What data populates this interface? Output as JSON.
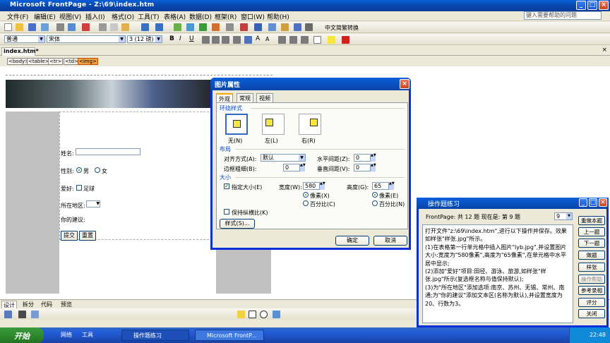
{
  "app": {
    "title": "Microsoft FrontPage - Z:\\69\\index.htm"
  },
  "menu": {
    "items": [
      "文件(F)",
      "编辑(E)",
      "视图(V)",
      "插入(I)",
      "格式(O)",
      "工具(T)",
      "表格(A)",
      "数据(D)",
      "框架(R)",
      "窗口(W)",
      "帮助(H)"
    ],
    "help_placeholder": "键入需要帮助的问题"
  },
  "format_toolbar": {
    "style": "普通",
    "font": "宋体",
    "size": "3 (12 磅)",
    "cn_convert": "中文简繁转换"
  },
  "doc_tab": "index.htm*",
  "tag_path": [
    "<body>",
    "<table>",
    "<tr>",
    "<td>",
    "<img>"
  ],
  "form": {
    "name_label": "姓名:",
    "gender_label": "性别:",
    "male": "男",
    "female": "女",
    "hobby_label": "爱好:",
    "hobby_option": "足球",
    "region_label": "所在地区:",
    "suggest_label": "你的建议:",
    "submit": "提交",
    "reset": "重置"
  },
  "view_tabs": [
    "设计",
    "拆分",
    "代码",
    "预览"
  ],
  "dialog": {
    "title": "图片属性",
    "tabs": [
      "外观",
      "常规",
      "视频"
    ],
    "wrap_section": "环绕样式",
    "wrap_options": [
      "无(N)",
      "左(L)",
      "右(R)"
    ],
    "layout_section": "布局",
    "align_label": "对齐方式(A):",
    "align_value": "默认",
    "hspace_label": "水平间距(Z):",
    "hspace_value": "0",
    "border_label": "边框粗细(B):",
    "border_value": "0",
    "vspace_label": "垂直间距(V):",
    "vspace_value": "0",
    "size_section": "大小",
    "specify_size": "指定大小(E)",
    "width_label": "宽度(W):",
    "width_value": "580",
    "height_label": "高度(G):",
    "height_value": "65",
    "pixels": "像素(X)",
    "percent": "百分比(C)",
    "pixels_h": "像素(E)",
    "percent_h": "百分比(N)",
    "keep_ratio": "保持纵横比(K)",
    "style_button": "样式(S)...",
    "ok": "确定",
    "cancel": "取消"
  },
  "practice": {
    "title": "操作题练习",
    "status": "FrontPage: 共 12 题  现在是: 第 9 题",
    "question_num": "9",
    "text": "打开文件\"z:\\69\\index.htm\",进行以下操作并保存。效果如样张\"样张.jpg\"所示。\n(1)在表格第一行单元格中插入图片\"lyb.jpg\",并设置图片大小:宽度为\"580像素\",高度为\"65像素\",在单元格中水平居中显示;\n(2)添加\"爱好\"项目:田径、游泳、旅游,如样张\"样张.jpg\"所示(复选框名称与值保持默认);\n(3)为\"所在地区\"添加选项:南京、苏州、无锡、常州、南通;为\"你的建议\"添加文本区(名称为默认),并设置宽度为20、行数为3。",
    "buttons": [
      "重做本题",
      "上一题",
      "下一题",
      "做题",
      "样张",
      "操作帮助",
      "参考录相",
      "评分",
      "关闭"
    ]
  },
  "taskbar": {
    "start": "开始",
    "quick": [
      "网络",
      "工具"
    ],
    "tasks": [
      "操作题练习",
      "Microsoft FrontP..."
    ],
    "clock": "22:48"
  },
  "colors": {
    "titlebar": "#0844a8",
    "taskbar": "#245edb",
    "start": "#2d8a2d"
  }
}
